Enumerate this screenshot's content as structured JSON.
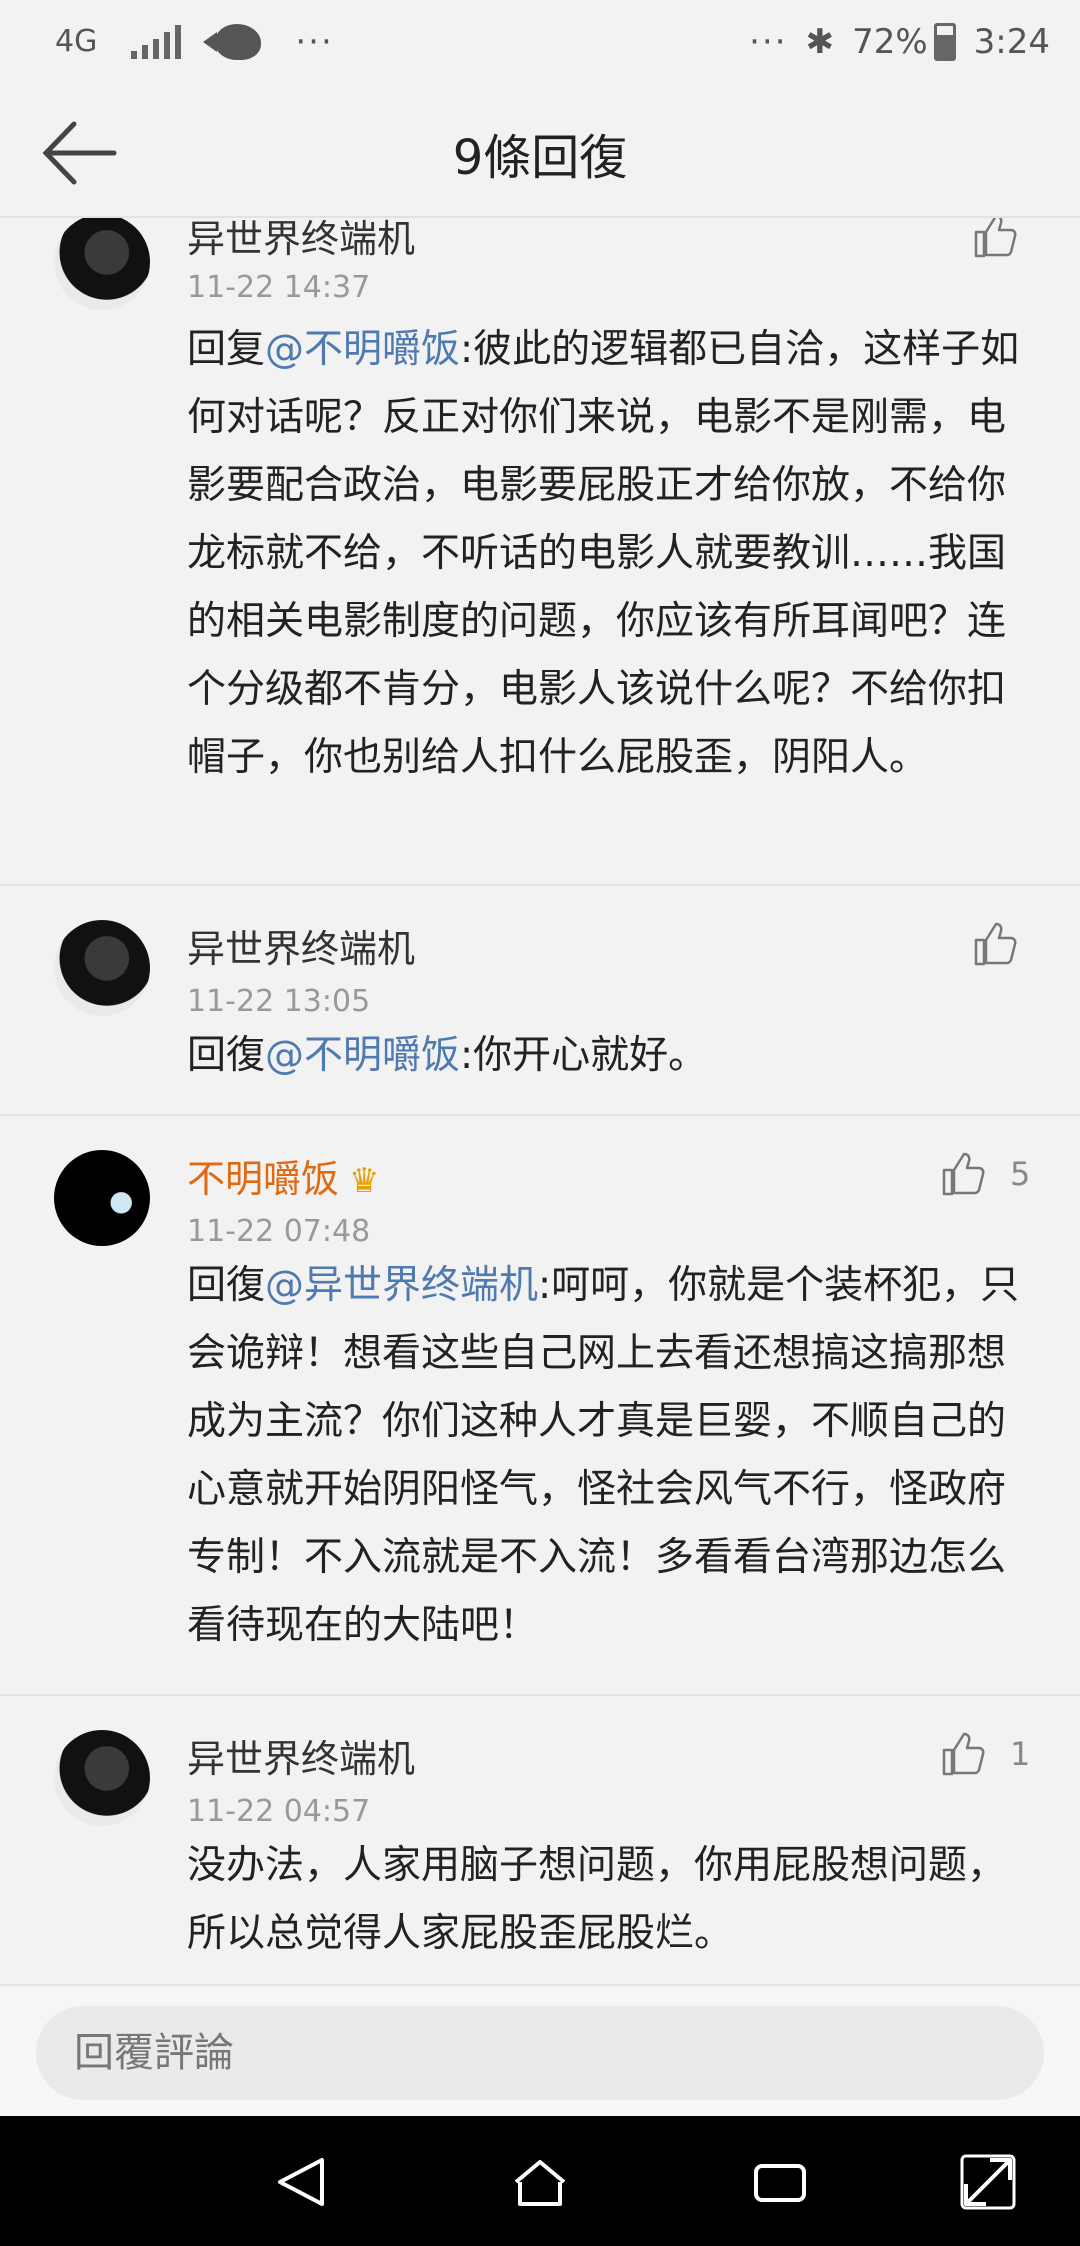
{
  "status_bar": {
    "network": "4G",
    "overflow_left": "···",
    "overflow_right": "···",
    "bluetooth_icon": "bluetooth-icon",
    "battery": "72%",
    "battery_level": 0.72,
    "time": "3:24"
  },
  "header": {
    "title": "9條回復",
    "back_icon": "arrow-left-icon"
  },
  "comments": [
    {
      "author": "异世界终端机",
      "time": "11-22 14:37",
      "likes": "",
      "reply_prefix": "回复",
      "mention": "@不明嚼饭",
      "text": ":彼此的逻辑都已自洽，这样子如何对话呢？反正对你们来说，电影不是刚需，电影要配合政治，电影要屁股正才给你放，不给你龙标就不给，不听话的电影人就要教训……我国的相关电影制度的问题，你应该有所耳闻吧？连个分级都不肯分，电影人该说什么呢？不给你扣帽子，你也别给人扣什么屁股歪，阴阳人。"
    },
    {
      "author": "异世界终端机",
      "time": "11-22 13:05",
      "likes": "",
      "reply_prefix": "回復",
      "mention": "@不明嚼饭",
      "text": ":你开心就好。"
    },
    {
      "author": "不明嚼饭",
      "crown_icon": "crown-icon",
      "time": "11-22 07:48",
      "likes": "5",
      "reply_prefix": "回復",
      "mention": "@异世界终端机",
      "text": ":呵呵，你就是个装杯犯，只会诡辩！想看这些自己网上去看还想搞这搞那想成为主流？你们这种人才真是巨婴，不顺自己的心意就开始阴阳怪气，怪社会风气不行，怪政府专制！不入流就是不入流！多看看台湾那边怎么看待现在的大陆吧！"
    },
    {
      "author": "异世界终端机",
      "time": "11-22 04:57",
      "likes": "1",
      "reply_prefix": "",
      "mention": "",
      "text": "没办法，人家用脑子想问题，你用屁股想问题，所以总觉得人家屁股歪屁股烂。"
    }
  ],
  "reply_bar": {
    "placeholder": "回覆評論"
  },
  "nav_bar": {
    "icons": [
      "back-triangle-icon",
      "home-icon",
      "recents-icon",
      "expand-icon"
    ]
  }
}
